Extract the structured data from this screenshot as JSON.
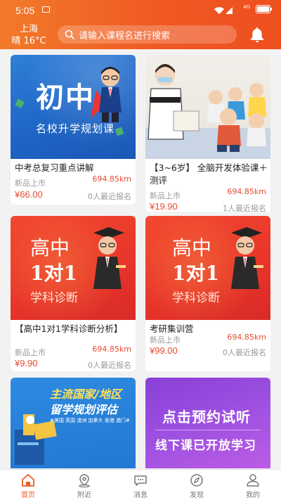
{
  "status": {
    "time": "5:05",
    "network": "4G"
  },
  "header": {
    "city": "上海",
    "weather": "晴 16°C",
    "search_placeholder": "请输入课程名进行搜索"
  },
  "courses": [
    {
      "title": "中考总复习重点讲解",
      "tag": "新品上市",
      "distance": "694.85km",
      "price": "¥66.00",
      "enrolled": "0人最近报名",
      "art_main": "初中",
      "art_sub": "名校升学规划课"
    },
    {
      "title": "【3~6岁】 全脑开发体验课＋测评",
      "tag": "新品上市",
      "distance": "694.85km",
      "price": "¥19.90",
      "enrolled": "1人最近报名"
    },
    {
      "title": "【高中1对1学科诊断分析】",
      "tag": "新品上市",
      "distance": "694.85km",
      "price": "¥9.90",
      "enrolled": "0人最近报名",
      "art_line1": "高中",
      "art_line2": "1对1",
      "art_line3": "学科诊断"
    },
    {
      "title": "考研集训营",
      "tag": "新品上市",
      "distance": "694.85km",
      "price": "¥99.00",
      "enrolled": "0人最近报名",
      "art_line1": "高中",
      "art_line2": "1对1",
      "art_line3": "学科诊断"
    },
    {
      "art_main": "主流国家/地区",
      "art_main2": "留学规划评估",
      "art_small": "#美国 英国 澳洲 加拿大 香港 澳门#"
    },
    {
      "art_main": "点击预约试听",
      "art_main2": "线下课已开放学习"
    }
  ],
  "tabs": [
    {
      "label": "首页",
      "icon": "home-icon"
    },
    {
      "label": "附近",
      "icon": "location-icon"
    },
    {
      "label": "消息",
      "icon": "message-icon"
    },
    {
      "label": "发现",
      "icon": "compass-icon"
    },
    {
      "label": "我的",
      "icon": "user-icon"
    }
  ],
  "colors": {
    "accent": "#f05a22",
    "price": "#e94a2d"
  }
}
